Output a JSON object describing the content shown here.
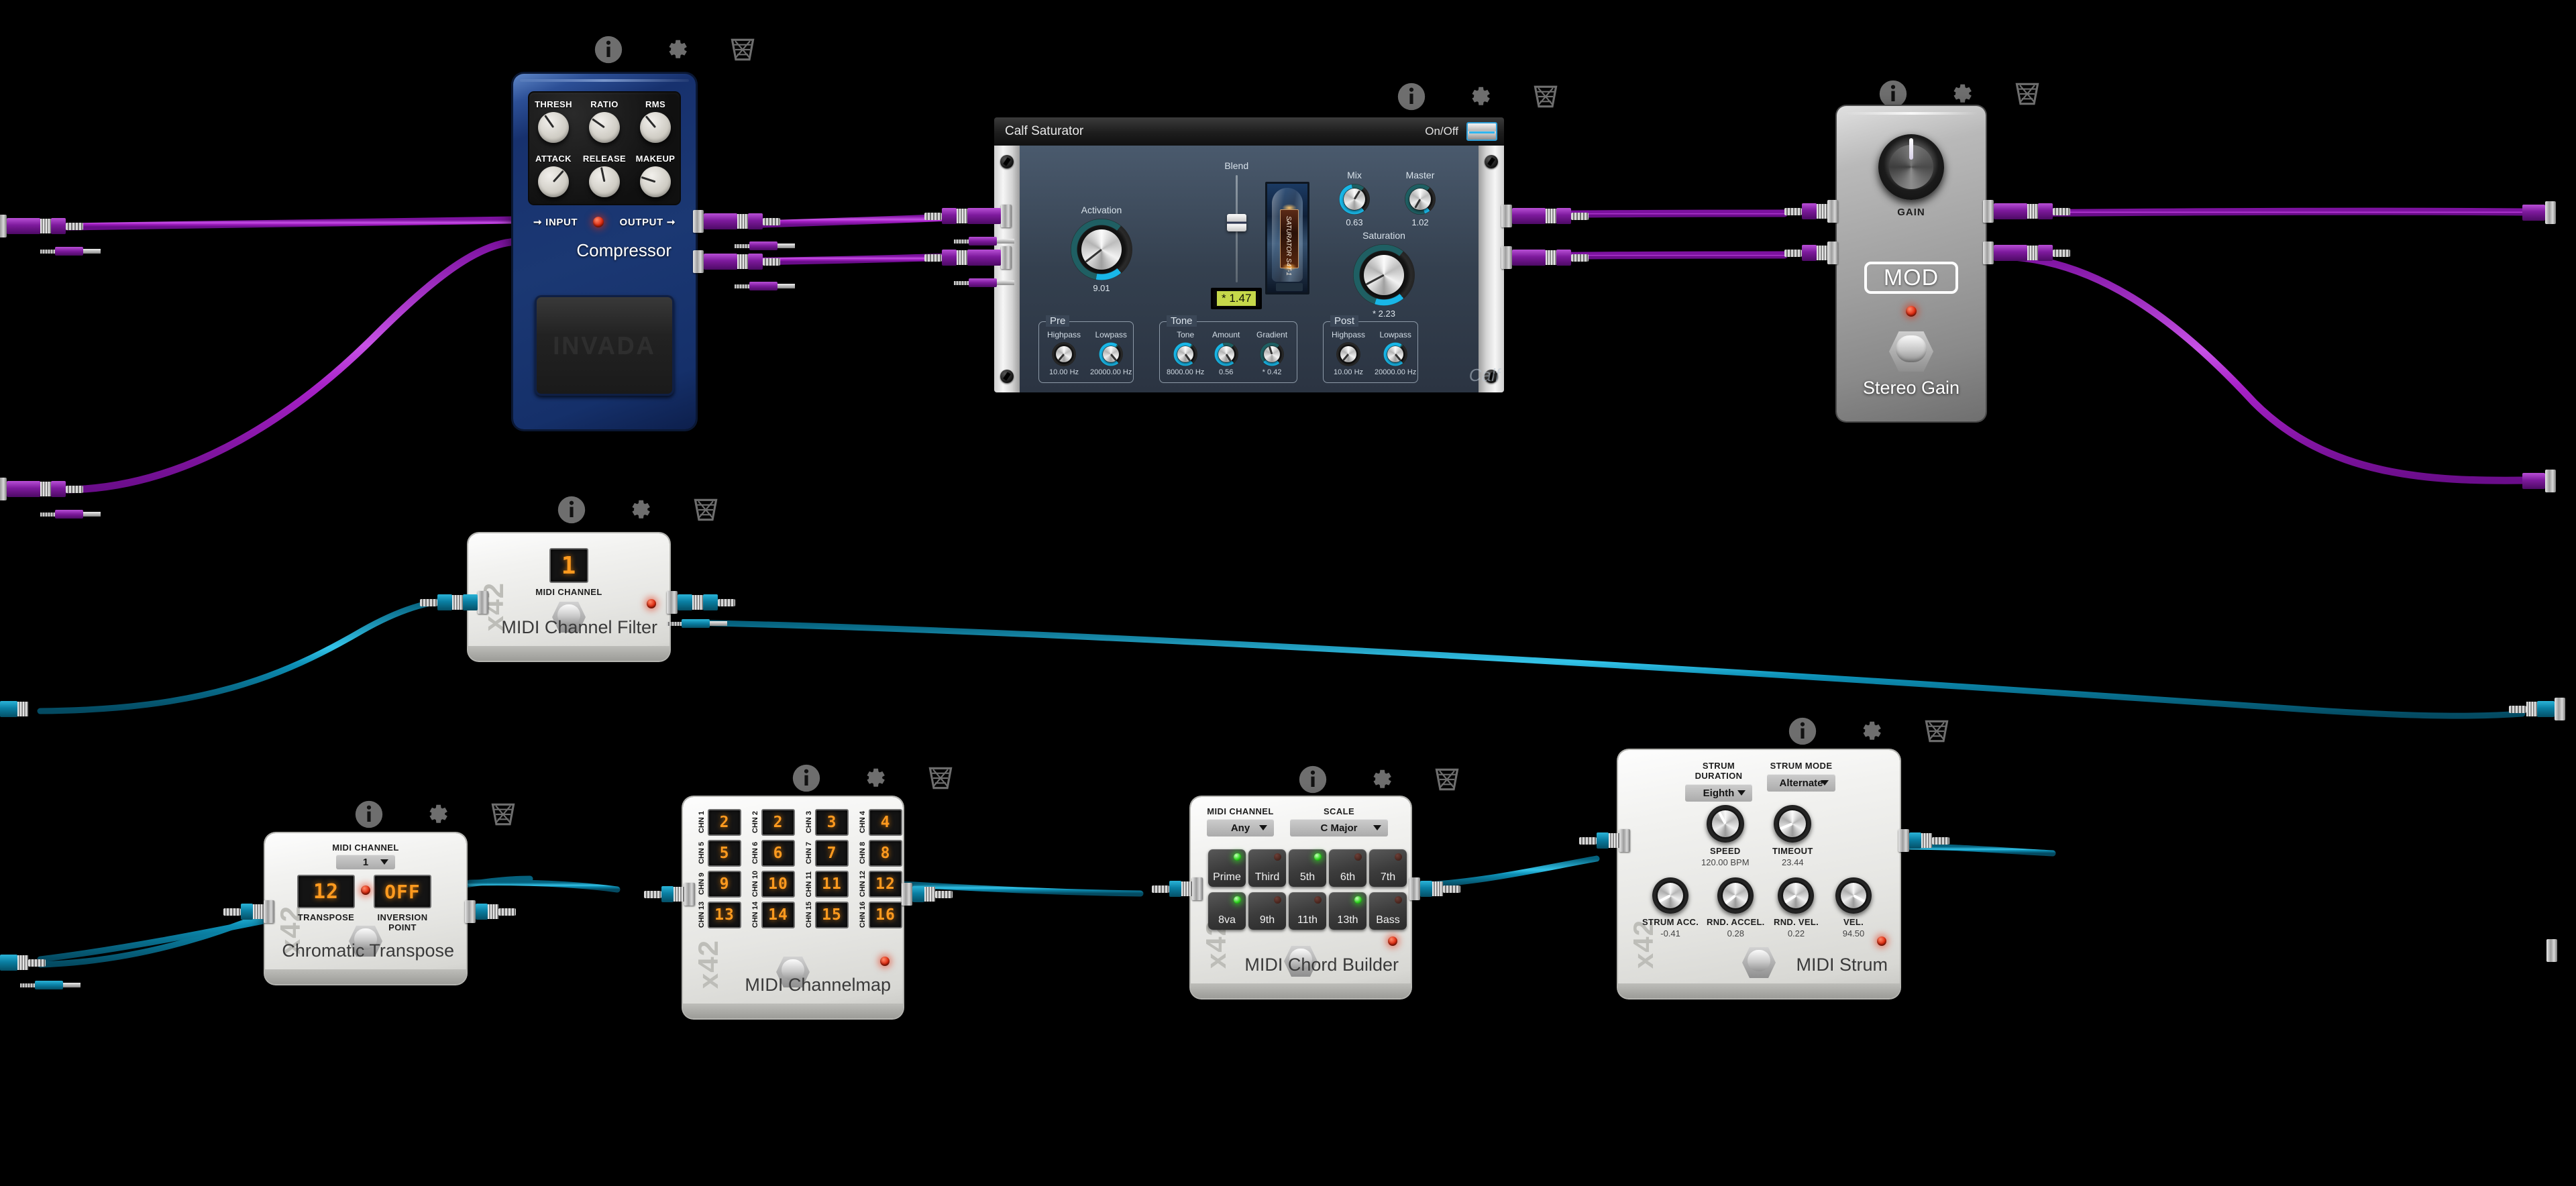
{
  "app": {
    "background_color": "#000000"
  },
  "toolbar_icons": [
    {
      "name": "info-icon",
      "glyph": "i"
    },
    {
      "name": "settings-gear-icon",
      "glyph": "gear"
    },
    {
      "name": "delete-trash-icon",
      "glyph": "trash"
    }
  ],
  "devices": [
    {
      "id": "compressor",
      "type": "audio-pedal",
      "name": "Compressor",
      "brand_footplate": "INVADA",
      "io_labels": {
        "input": "INPUT",
        "output": "OUTPUT"
      },
      "led": "on",
      "knobs": [
        {
          "label": "THRESH",
          "angle": -35
        },
        {
          "label": "RATIO",
          "angle": -55
        },
        {
          "label": "RMS",
          "angle": -40
        },
        {
          "label": "ATTACK",
          "angle": 42
        },
        {
          "label": "RELEASE",
          "angle": -12
        },
        {
          "label": "MAKEUP",
          "angle": -72
        }
      ]
    },
    {
      "id": "calf-saturator",
      "type": "plugin-window",
      "title": "Calf Saturator",
      "on_off_label": "On/Off",
      "on_off_state": "on",
      "tube_label": "Calf",
      "tube_sublabel": "SATURATOR S4T-1",
      "logo": "Calf",
      "main_knobs": [
        {
          "label": "Activation",
          "value": "9.01",
          "angle": -128
        },
        {
          "label": "Saturation",
          "value": "* 2.23",
          "angle": -118
        },
        {
          "label": "Mix",
          "value": "0.63",
          "angle": 32
        },
        {
          "label": "Master",
          "value": "1.02",
          "angle": -150
        }
      ],
      "blend": {
        "label": "Blend",
        "value": "* 1.47"
      },
      "groups": [
        {
          "title": "Pre",
          "knobs": [
            {
              "label": "Highpass",
              "value": "10.00 Hz",
              "angle": -140
            },
            {
              "label": "Lowpass",
              "value": "20000.00 Hz",
              "angle": 140
            }
          ]
        },
        {
          "title": "Tone",
          "knobs": [
            {
              "label": "Tone",
              "value": "8000.00 Hz",
              "angle": 145
            },
            {
              "label": "Amount",
              "value": "0.56",
              "angle": 148
            },
            {
              "label": "Gradient",
              "value": "* 0.42",
              "angle": -18
            }
          ]
        },
        {
          "title": "Post",
          "knobs": [
            {
              "label": "Highpass",
              "value": "10.00 Hz",
              "angle": -140
            },
            {
              "label": "Lowpass",
              "value": "20000.00 Hz",
              "angle": 140
            }
          ]
        }
      ]
    },
    {
      "id": "stereo-gain",
      "type": "audio-pedal",
      "name": "Stereo Gain",
      "knob_label": "GAIN",
      "knob_angle": 0,
      "badge": "MOD",
      "led": "on"
    },
    {
      "id": "midi-channel-filter",
      "type": "midi-pedal",
      "brand": "x42",
      "name": "MIDI Channel Filter",
      "display_label": "MIDI CHANNEL",
      "display_value": "1",
      "led": "on"
    },
    {
      "id": "chromatic-transpose",
      "type": "midi-pedal",
      "brand": "x42",
      "name": "Chromatic Transpose",
      "select_label": "MIDI CHANNEL",
      "select_value": "1",
      "displays": [
        {
          "label": "TRANSPOSE",
          "value": "12"
        },
        {
          "label": "INVERSION POINT",
          "value": "OFF"
        }
      ],
      "led": "on"
    },
    {
      "id": "midi-channelmap",
      "type": "midi-pedal",
      "brand": "x42",
      "name": "MIDI Channelmap",
      "channels": [
        {
          "label": "CHN 1",
          "value": "2"
        },
        {
          "label": "CHN 2",
          "value": "2"
        },
        {
          "label": "CHN 3",
          "value": "3"
        },
        {
          "label": "CHN 4",
          "value": "4"
        },
        {
          "label": "CHN 5",
          "value": "5"
        },
        {
          "label": "CHN 6",
          "value": "6"
        },
        {
          "label": "CHN 7",
          "value": "7"
        },
        {
          "label": "CHN 8",
          "value": "8"
        },
        {
          "label": "CHN 9",
          "value": "9"
        },
        {
          "label": "CHN 10",
          "value": "10"
        },
        {
          "label": "CHN 11",
          "value": "11"
        },
        {
          "label": "CHN 12",
          "value": "12"
        },
        {
          "label": "CHN 13",
          "value": "13"
        },
        {
          "label": "CHN 14",
          "value": "14"
        },
        {
          "label": "CHN 15",
          "value": "15"
        },
        {
          "label": "CHN 16",
          "value": "16"
        }
      ],
      "led": "on"
    },
    {
      "id": "midi-chord-builder",
      "type": "midi-pedal",
      "brand": "x42",
      "name": "MIDI Chord Builder",
      "selects": [
        {
          "label": "MIDI CHANNEL",
          "value": "Any"
        },
        {
          "label": "SCALE",
          "value": "C Major"
        }
      ],
      "buttons": [
        {
          "label": "Prime",
          "state": "on"
        },
        {
          "label": "Third",
          "state": "off"
        },
        {
          "label": "5th",
          "state": "on"
        },
        {
          "label": "6th",
          "state": "off"
        },
        {
          "label": "7th",
          "state": "off"
        },
        {
          "label": "8va",
          "state": "on"
        },
        {
          "label": "9th",
          "state": "off"
        },
        {
          "label": "11th",
          "state": "off"
        },
        {
          "label": "13th",
          "state": "on"
        },
        {
          "label": "Bass",
          "state": "off"
        }
      ],
      "led": "on"
    },
    {
      "id": "midi-strum",
      "type": "midi-pedal",
      "brand": "x42",
      "name": "MIDI Strum",
      "selects": [
        {
          "label": "STRUM DURATION",
          "value": "Eighth"
        },
        {
          "label": "STRUM MODE",
          "value": "Alternate"
        }
      ],
      "knobs": [
        {
          "label": "SPEED",
          "value": "120.00 BPM",
          "angle": -28
        },
        {
          "label": "TIMEOUT",
          "value": "23.44",
          "angle": -112
        },
        {
          "label": "STRUM ACC.",
          "value": "-0.41",
          "angle": -118
        },
        {
          "label": "RND. ACCEL.",
          "value": "0.28",
          "angle": -128
        },
        {
          "label": "RND. VEL.",
          "value": "0.22",
          "angle": -122
        },
        {
          "label": "VEL.",
          "value": "94.50",
          "angle": 118
        }
      ],
      "led": "on"
    }
  ],
  "cables": {
    "audio_color": "#a822c8",
    "midi_color": "#0d8fb5",
    "audio_count": 6,
    "midi_count": 6
  }
}
